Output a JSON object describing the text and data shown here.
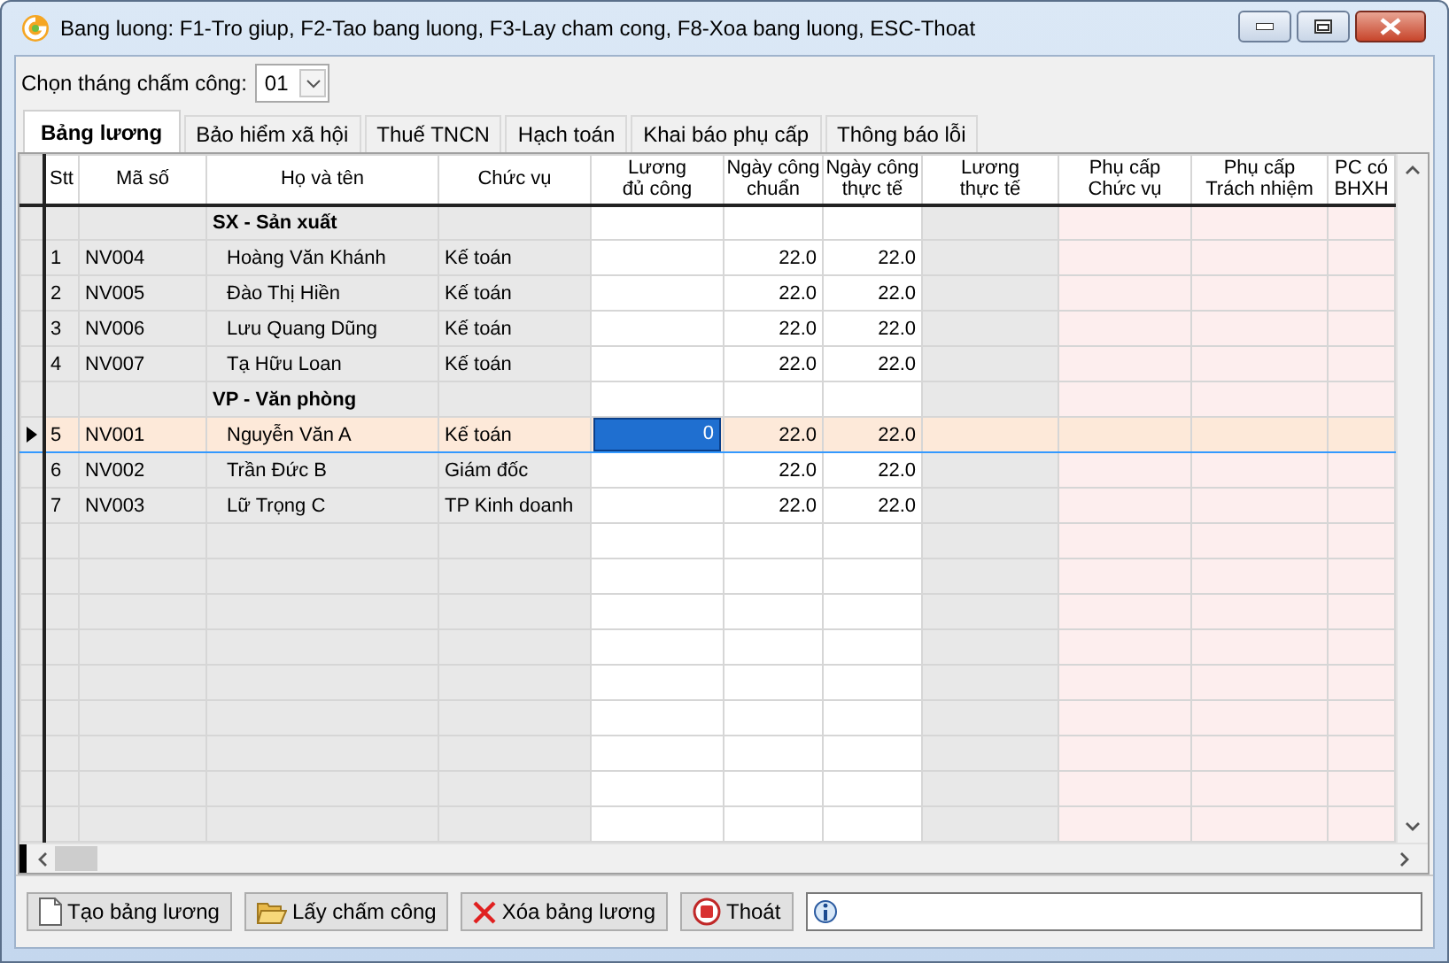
{
  "window": {
    "title": "Bang luong: F1-Tro giup, F2-Tao bang luong, F3-Lay cham cong, F8-Xoa bang luong, ESC-Thoat"
  },
  "month_picker": {
    "label": "Chọn tháng chấm công:",
    "value": "01"
  },
  "tabs": [
    {
      "label": "Bảng lương",
      "selected": true
    },
    {
      "label": "Bảo hiểm xã hội",
      "selected": false
    },
    {
      "label": "Thuế TNCN",
      "selected": false
    },
    {
      "label": "Hạch toán",
      "selected": false
    },
    {
      "label": "Khai báo phụ cấp",
      "selected": false
    },
    {
      "label": "Thông báo lỗi",
      "selected": false
    }
  ],
  "table": {
    "columns": [
      {
        "label": "Stt",
        "kind": "gray"
      },
      {
        "label": "Mã số",
        "kind": "gray"
      },
      {
        "label": "Họ và tên",
        "kind": "gray"
      },
      {
        "label": "Chức vụ",
        "kind": "gray"
      },
      {
        "label": "Lương\nđủ công",
        "kind": "white"
      },
      {
        "label": "Ngày công\nchuẩn",
        "kind": "white"
      },
      {
        "label": "Ngày công\nthực tế",
        "kind": "white"
      },
      {
        "label": "Lương\nthực tế",
        "kind": "gray"
      },
      {
        "label": "Phụ cấp\nChức vụ",
        "kind": "pink"
      },
      {
        "label": "Phụ cấp\nTrách nhiệm",
        "kind": "pink"
      },
      {
        "label": "PC có\nBHXH",
        "kind": "pink"
      }
    ],
    "rows": [
      {
        "kind": "group",
        "label": "SX - Sản xuất"
      },
      {
        "kind": "employee",
        "selected": false,
        "stt": "1",
        "code": "NV004",
        "name": "Hoàng Văn Khánh",
        "position": "Kế toán",
        "standard_days": "22.0",
        "actual_days": "22.0"
      },
      {
        "kind": "employee",
        "selected": false,
        "stt": "2",
        "code": "NV005",
        "name": "Đào Thị Hiền",
        "position": "Kế toán",
        "standard_days": "22.0",
        "actual_days": "22.0"
      },
      {
        "kind": "employee",
        "selected": false,
        "stt": "3",
        "code": "NV006",
        "name": "Lưu Quang Dũng",
        "position": "Kế toán",
        "standard_days": "22.0",
        "actual_days": "22.0"
      },
      {
        "kind": "employee",
        "selected": false,
        "stt": "4",
        "code": "NV007",
        "name": "Tạ Hữu Loan",
        "position": "Kế toán",
        "standard_days": "22.0",
        "actual_days": "22.0"
      },
      {
        "kind": "group",
        "label": "VP - Văn phòng"
      },
      {
        "kind": "employee",
        "selected": true,
        "stt": "5",
        "code": "NV001",
        "name": "Nguyễn Văn A",
        "position": "Kế toán",
        "full_salary": "0",
        "standard_days": "22.0",
        "actual_days": "22.0"
      },
      {
        "kind": "employee",
        "selected": false,
        "stt": "6",
        "code": "NV002",
        "name": "Trần Đức B",
        "position": "Giám đốc",
        "standard_days": "22.0",
        "actual_days": "22.0"
      },
      {
        "kind": "employee",
        "selected": false,
        "stt": "7",
        "code": "NV003",
        "name": "Lữ Trọng C",
        "position": "TP Kinh doanh",
        "standard_days": "22.0",
        "actual_days": "22.0"
      }
    ]
  },
  "buttons": [
    {
      "label": "Tạo bảng lương",
      "kind": "new"
    },
    {
      "label": "Lấy chấm công",
      "kind": "open"
    },
    {
      "label": "Xóa bảng lương",
      "kind": "delete"
    },
    {
      "label": "Thoát",
      "kind": "stop"
    }
  ]
}
